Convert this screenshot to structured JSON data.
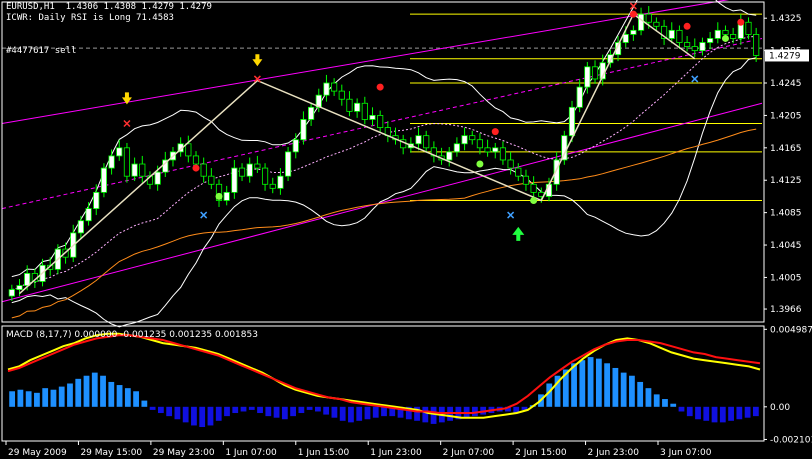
{
  "header": {
    "symbol_line": "EURUSD,H1  1.4306 1.4308 1.4279 1.4279",
    "indicator_line": "ICWR: Daily RSI is Long 71.4583",
    "order_label": "#4477617 sell"
  },
  "colors": {
    "background": "#000000",
    "bull_candle": "#ffffff",
    "bear_candle": "#000000",
    "candle_outline": "#00ff00",
    "bollinger": "#ffffff",
    "ma_slow": "#ff8c1a",
    "channel": "#ff00ff",
    "fib_level": "#ffff00",
    "macd_hist_pos": "#1e90ff",
    "macd_hist_neg": "#1010e0",
    "macd_line": "#ffff00",
    "signal_line": "#ff1010",
    "current_price_tag": "#ffffff"
  },
  "chart_data": [
    {
      "type": "candlestick",
      "symbol": "EURUSD",
      "timeframe": "H1",
      "ohlc_last": {
        "open": 1.4306,
        "high": 1.4308,
        "low": 1.4279,
        "close": 1.4279
      },
      "current_price": "1.4279",
      "ylim": [
        1.395,
        1.4345
      ],
      "y_ticks": [
        "1.4325",
        "1.4285",
        "1.4245",
        "1.4205",
        "1.4165",
        "1.4125",
        "1.4085",
        "1.4045",
        "1.4005",
        "1.3966"
      ],
      "x_ticks": [
        "29 May 2009",
        "29 May 15:00",
        "29 May 23:00",
        "1 Jun 07:00",
        "1 Jun 15:00",
        "1 Jun 23:00",
        "2 Jun 07:00",
        "2 Jun 15:00",
        "2 Jun 23:00",
        "3 Jun 07:00"
      ],
      "horizontal_levels": [
        1.433,
        1.4275,
        1.4245,
        1.4195,
        1.416,
        1.41
      ],
      "order_price": 1.4288,
      "closes": [
        1.399,
        1.3995,
        1.401,
        1.4,
        1.402,
        1.4015,
        1.404,
        1.403,
        1.406,
        1.4075,
        1.409,
        1.411,
        1.414,
        1.4155,
        1.4165,
        1.413,
        1.4145,
        1.413,
        1.412,
        1.4135,
        1.415,
        1.416,
        1.417,
        1.4155,
        1.4145,
        1.413,
        1.412,
        1.41,
        1.411,
        1.414,
        1.413,
        1.4145,
        1.414,
        1.412,
        1.4115,
        1.413,
        1.416,
        1.4175,
        1.42,
        1.4215,
        1.423,
        1.4245,
        1.4235,
        1.4225,
        1.421,
        1.422,
        1.42,
        1.4205,
        1.419,
        1.418,
        1.4175,
        1.4165,
        1.417,
        1.418,
        1.4165,
        1.4155,
        1.415,
        1.416,
        1.417,
        1.418,
        1.4175,
        1.4165,
        1.416,
        1.4165,
        1.415,
        1.414,
        1.413,
        1.412,
        1.411,
        1.4105,
        1.412,
        1.415,
        1.418,
        1.4215,
        1.424,
        1.4265,
        1.425,
        1.427,
        1.428,
        1.4295,
        1.4305,
        1.431,
        1.433,
        1.432,
        1.4315,
        1.43,
        1.431,
        1.4295,
        1.429,
        1.4285,
        1.4295,
        1.43,
        1.431,
        1.4305,
        1.43,
        1.432,
        1.4305,
        1.4279
      ],
      "markers": [
        {
          "kind": "sell_arrow",
          "index": 15,
          "price": 1.4215
        },
        {
          "kind": "sell_arrow",
          "index": 32,
          "price": 1.4262
        },
        {
          "kind": "buy_arrow",
          "index": 66,
          "price": 1.406
        },
        {
          "kind": "cross_red",
          "index": 15,
          "price": 1.4195
        },
        {
          "kind": "cross_red",
          "index": 32,
          "price": 1.425
        },
        {
          "kind": "cross_red",
          "index": 81,
          "price": 1.434
        },
        {
          "kind": "cross_blue",
          "index": 25,
          "price": 1.4082
        },
        {
          "kind": "cross_blue",
          "index": 65,
          "price": 1.4082
        },
        {
          "kind": "cross_blue",
          "index": 89,
          "price": 1.425
        },
        {
          "kind": "dot_red",
          "index": 24,
          "price": 1.414
        },
        {
          "kind": "dot_red",
          "index": 48,
          "price": 1.424
        },
        {
          "kind": "dot_red",
          "index": 63,
          "price": 1.4185
        },
        {
          "kind": "dot_red",
          "index": 81,
          "price": 1.433
        },
        {
          "kind": "dot_red",
          "index": 88,
          "price": 1.4315
        },
        {
          "kind": "dot_red",
          "index": 95,
          "price": 1.432
        },
        {
          "kind": "dot_green",
          "index": 27,
          "price": 1.4105
        },
        {
          "kind": "dot_green",
          "index": 61,
          "price": 1.4145
        },
        {
          "kind": "dot_green",
          "index": 68,
          "price": 1.41
        },
        {
          "kind": "dot_green",
          "index": 93,
          "price": 1.43
        }
      ]
    },
    {
      "type": "macd",
      "label": "MACD (8,17,7) 0.000000 -0.001235 0.001235 0.001853",
      "ylim": [
        -0.0022,
        0.0052
      ],
      "y_ticks": [
        "0.004987",
        "0.00",
        "-0.002101"
      ],
      "histogram": [
        0.001,
        0.0011,
        0.001,
        0.0009,
        0.0012,
        0.0011,
        0.0013,
        0.0015,
        0.0018,
        0.002,
        0.0022,
        0.002,
        0.0016,
        0.0014,
        0.0012,
        0.001,
        0.0004,
        -0.0002,
        -0.0004,
        -0.0006,
        -0.0008,
        -0.001,
        -0.0012,
        -0.0013,
        -0.0012,
        -0.0009,
        -0.0006,
        -0.0004,
        -0.0003,
        -0.0002,
        -0.0004,
        -0.0006,
        -0.0007,
        -0.0008,
        -0.0006,
        -0.0004,
        -0.0002,
        -0.0003,
        -0.0005,
        -0.0007,
        -0.0009,
        -0.001,
        -0.0009,
        -0.0008,
        -0.0007,
        -0.0006,
        -0.0006,
        -0.0007,
        -0.0008,
        -0.0009,
        -0.001,
        -0.0011,
        -0.001,
        -0.0009,
        -0.0008,
        -0.0007,
        -0.0006,
        -0.0005,
        -0.0004,
        -0.0003,
        -0.0003,
        -0.0004,
        -0.0002,
        0.0001,
        0.0008,
        0.0015,
        0.002,
        0.0024,
        0.0028,
        0.003,
        0.0032,
        0.0031,
        0.0028,
        0.0025,
        0.0022,
        0.002,
        0.0016,
        0.0012,
        0.0008,
        0.0005,
        0.0002,
        -0.0003,
        -0.0006,
        -0.0008,
        -0.0009,
        -0.001,
        -0.001,
        -0.0009,
        -0.0008,
        -0.0007,
        -0.0006
      ],
      "macd_line": [
        0.0024,
        0.0026,
        0.003,
        0.0033,
        0.0036,
        0.0039,
        0.0041,
        0.0044,
        0.0046,
        0.0047,
        0.0047,
        0.0046,
        0.0045,
        0.0043,
        0.0041,
        0.004,
        0.0039,
        0.0038,
        0.0036,
        0.0034,
        0.0031,
        0.0028,
        0.0025,
        0.0022,
        0.0018,
        0.0014,
        0.0011,
        0.0009,
        0.0007,
        0.0006,
        0.0005,
        0.0004,
        0.0003,
        0.0002,
        0.0001,
        0.0,
        -0.0001,
        -0.0002,
        -0.0004,
        -0.0005,
        -0.0006,
        -0.0007,
        -0.0007,
        -0.0007,
        -0.0006,
        -0.0005,
        -0.0004,
        -0.0002,
        0.0003,
        0.001,
        0.0018,
        0.0025,
        0.0031,
        0.0036,
        0.004,
        0.0043,
        0.0044,
        0.0043,
        0.0041,
        0.0038,
        0.0035,
        0.0033,
        0.0031,
        0.003,
        0.0029,
        0.0028,
        0.0027,
        0.0026,
        0.0024
      ],
      "signal_line": [
        0.0023,
        0.0025,
        0.0028,
        0.0031,
        0.0034,
        0.0037,
        0.004,
        0.0042,
        0.0044,
        0.0045,
        0.0046,
        0.0046,
        0.0045,
        0.0044,
        0.0043,
        0.0041,
        0.0039,
        0.0037,
        0.0035,
        0.0033,
        0.003,
        0.0027,
        0.0024,
        0.0021,
        0.0018,
        0.0015,
        0.0012,
        0.001,
        0.0008,
        0.0006,
        0.0005,
        0.0003,
        0.0002,
        0.0001,
        0.0,
        -0.0001,
        -0.0002,
        -0.0003,
        -0.0003,
        -0.0004,
        -0.0004,
        -0.0004,
        -0.0004,
        -0.0003,
        -0.0002,
        -0.0001,
        0.0002,
        0.0007,
        0.0013,
        0.0019,
        0.0024,
        0.0029,
        0.0033,
        0.0037,
        0.004,
        0.0042,
        0.0043,
        0.0043,
        0.0042,
        0.0041,
        0.0039,
        0.0037,
        0.0035,
        0.0034,
        0.0032,
        0.0031,
        0.003,
        0.0029,
        0.0028
      ]
    }
  ]
}
